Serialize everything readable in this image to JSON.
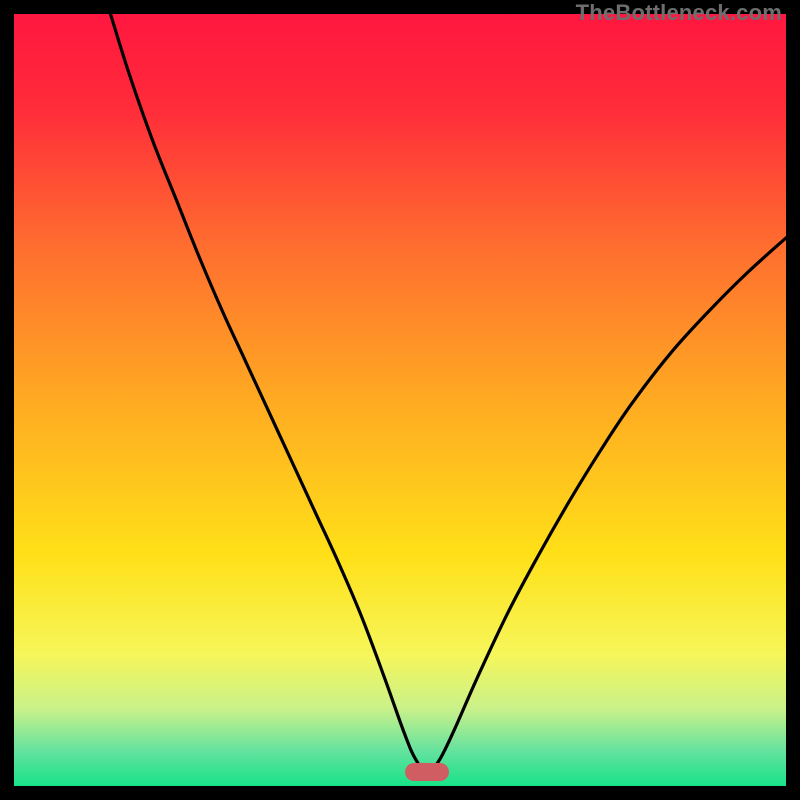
{
  "watermark": "TheBottleneck.com",
  "colors": {
    "gradient_stops": [
      {
        "offset": 0.0,
        "color": "#ff173f"
      },
      {
        "offset": 0.12,
        "color": "#ff2b3a"
      },
      {
        "offset": 0.3,
        "color": "#ff6d2f"
      },
      {
        "offset": 0.5,
        "color": "#ffaa22"
      },
      {
        "offset": 0.7,
        "color": "#ffe018"
      },
      {
        "offset": 0.83,
        "color": "#f6f65a"
      },
      {
        "offset": 0.9,
        "color": "#c9f18a"
      },
      {
        "offset": 0.955,
        "color": "#63e29e"
      },
      {
        "offset": 1.0,
        "color": "#18e388"
      }
    ],
    "curve": "#000000",
    "marker": "#cf5d62"
  },
  "chart_data": {
    "type": "line",
    "title": "",
    "xlabel": "",
    "ylabel": "",
    "xlim": [
      0,
      100
    ],
    "ylim": [
      0,
      100
    ],
    "grid": false,
    "legend": false,
    "note": "Axes are unlabeled; values estimated from pixel positions as 0–100 scale.",
    "marker": {
      "x": 53.5,
      "y": 1.8
    },
    "series": [
      {
        "name": "curve",
        "x": [
          12.5,
          15,
          18,
          21,
          24,
          27,
          30,
          33,
          36,
          39,
          42,
          45,
          48,
          50.5,
          52,
          53.5,
          55,
          57,
          60,
          64,
          68,
          72,
          76,
          80,
          85,
          90,
          95,
          100
        ],
        "y": [
          100,
          92,
          83.5,
          76,
          68.5,
          61.5,
          55,
          48.5,
          42,
          35.5,
          29,
          22,
          14,
          7,
          3.5,
          1.8,
          3.2,
          7.2,
          14,
          22.5,
          30,
          37,
          43.5,
          49.5,
          56,
          61.5,
          66.5,
          71
        ]
      }
    ]
  }
}
